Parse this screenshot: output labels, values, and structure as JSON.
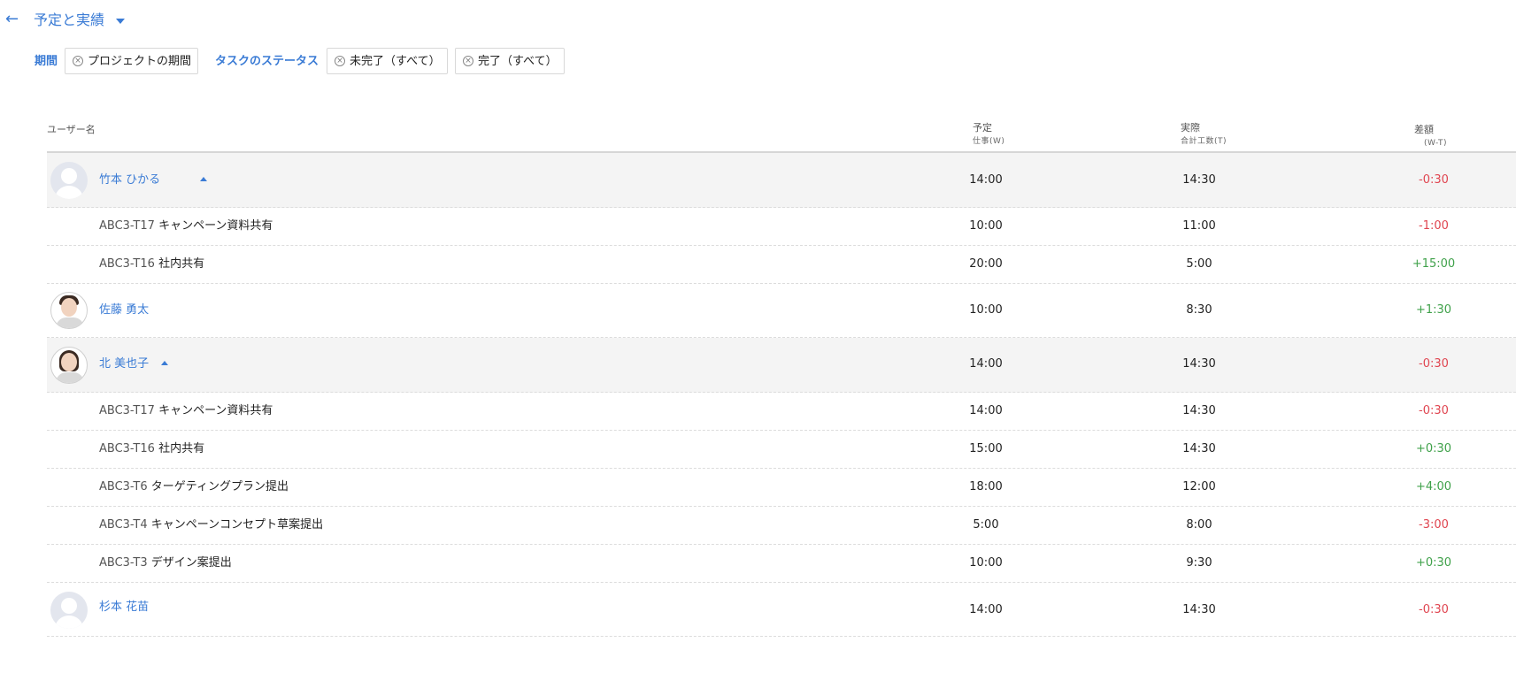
{
  "header": {
    "back_icon": "arrow-left-icon",
    "title": "予定と実績",
    "title_caret_icon": "caret-down-icon"
  },
  "filters": {
    "period_label": "期間",
    "period_chip": "プロジェクトの期間",
    "status_label": "タスクのステータス",
    "status_chip_1": "未完了（すべて）",
    "status_chip_2": "完了（すべて）",
    "chip_remove_icon": "circle-x-icon"
  },
  "columns": {
    "user": "ユーザー名",
    "planned": "予定",
    "planned_sub": "仕事(W)",
    "actual": "実際",
    "actual_sub": "合計工数(T)",
    "diff": "差額",
    "diff_sub": "(W-T)"
  },
  "rows": [
    {
      "kind": "user",
      "name": "竹本 ひかる",
      "planned": "14:00",
      "actual": "14:30",
      "diff": "-0:30",
      "expanded": true
    },
    {
      "kind": "task",
      "code": "ABC3-T17",
      "title": "キャンペーン資料共有",
      "planned": "10:00",
      "actual": "11:00",
      "diff": "-1:00"
    },
    {
      "kind": "task",
      "code": "ABC3-T16",
      "title": "社内共有",
      "planned": "20:00",
      "actual": "5:00",
      "diff": "+15:00"
    },
    {
      "kind": "user",
      "name": "佐藤 勇太",
      "planned": "10:00",
      "actual": "8:30",
      "diff": "+1:30",
      "expanded": false
    },
    {
      "kind": "user",
      "name": "北 美也子",
      "planned": "14:00",
      "actual": "14:30",
      "diff": "-0:30",
      "expanded": true
    },
    {
      "kind": "task",
      "code": "ABC3-T17",
      "title": "キャンペーン資料共有",
      "planned": "14:00",
      "actual": "14:30",
      "diff": "-0:30"
    },
    {
      "kind": "task",
      "code": "ABC3-T16",
      "title": "社内共有",
      "planned": "15:00",
      "actual": "14:30",
      "diff": "+0:30"
    },
    {
      "kind": "task",
      "code": "ABC3-T6",
      "title": "ターゲティングプラン提出",
      "planned": "18:00",
      "actual": "12:00",
      "diff": "+4:00"
    },
    {
      "kind": "task",
      "code": "ABC3-T4",
      "title": "キャンペーンコンセプト草案提出",
      "planned": "5:00",
      "actual": "8:00",
      "diff": "-3:00"
    },
    {
      "kind": "task",
      "code": "ABC3-T3",
      "title": "デザイン案提出",
      "planned": "10:00",
      "actual": "9:30",
      "diff": "+0:30"
    },
    {
      "kind": "user",
      "name": "杉本 花苗",
      "planned": "14:00",
      "actual": "14:30",
      "diff": "-0:30",
      "expanded": false
    }
  ],
  "colors": {
    "accent": "#3a7bd5",
    "negative": "#e04550",
    "positive": "#3fa14a"
  }
}
